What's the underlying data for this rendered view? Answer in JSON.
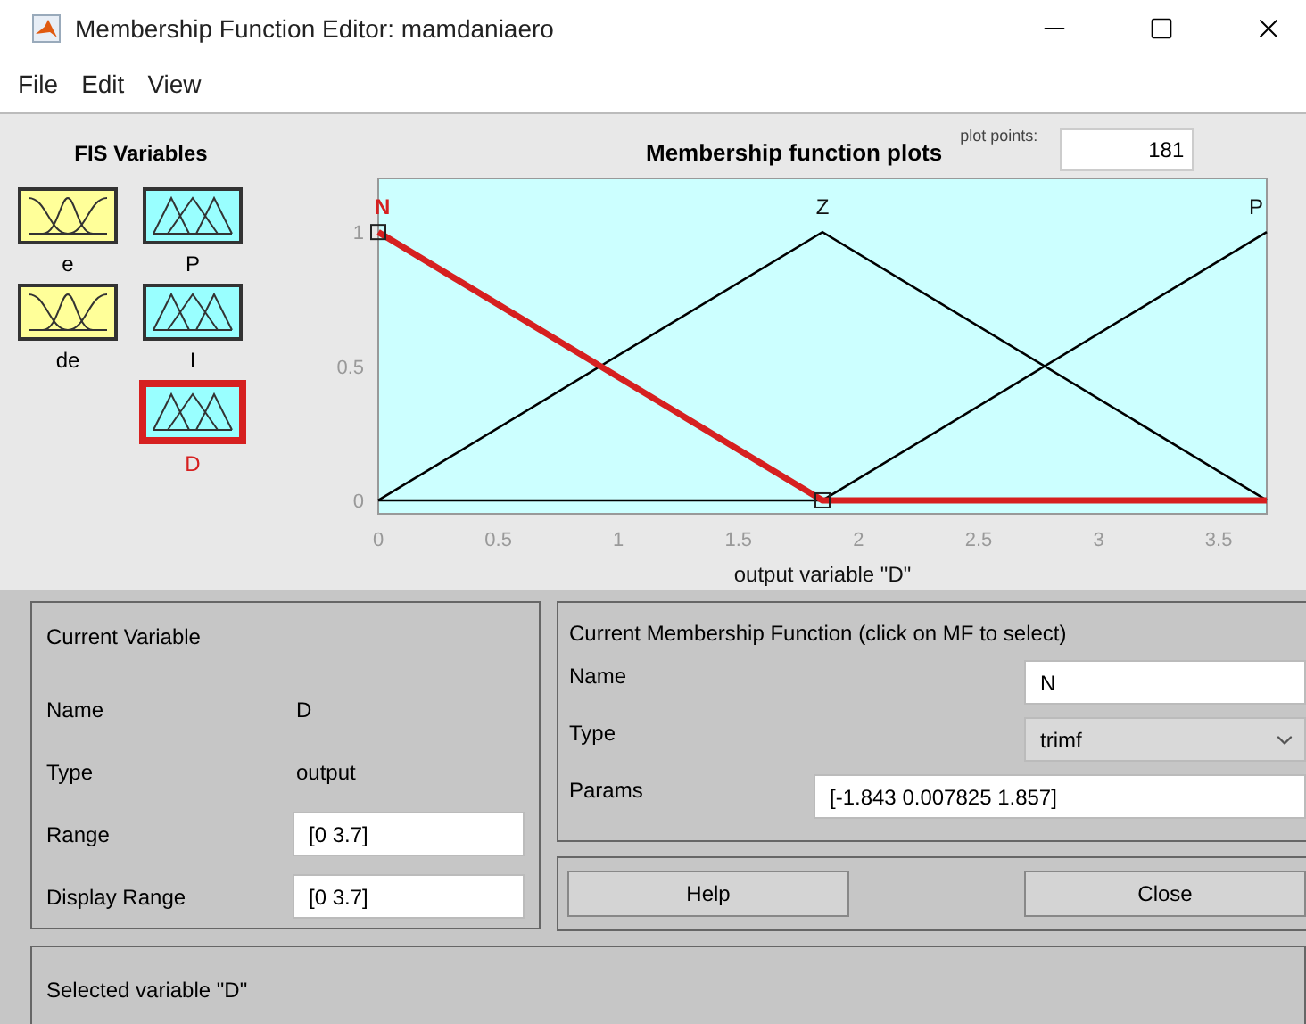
{
  "window": {
    "title": "Membership Function Editor: mamdaniaero"
  },
  "menu": [
    "File",
    "Edit",
    "View"
  ],
  "fis_variables": {
    "title": "FIS Variables",
    "items": [
      {
        "label": "e",
        "kind": "input",
        "selected": false
      },
      {
        "label": "de",
        "kind": "input",
        "selected": false
      },
      {
        "label": "P",
        "kind": "output",
        "selected": false
      },
      {
        "label": "I",
        "kind": "output",
        "selected": false
      },
      {
        "label": "D",
        "kind": "output",
        "selected": true
      }
    ]
  },
  "plot": {
    "title": "Membership function plots",
    "plot_points_label": "plot points:",
    "plot_points": "181",
    "chart_data": {
      "type": "line",
      "xlabel": "output variable \"D\"",
      "x": [
        0,
        1.85,
        3.7
      ],
      "series": [
        {
          "name": "N",
          "color": "#d62020",
          "values": [
            1,
            0,
            0
          ]
        },
        {
          "name": "Z",
          "color": "#000000",
          "values": [
            0,
            1,
            0
          ]
        },
        {
          "name": "P",
          "color": "#000000",
          "values": [
            0,
            0,
            1
          ]
        }
      ],
      "xlim": [
        0,
        3.7
      ],
      "ylim": [
        -0.05,
        1.2
      ],
      "xticks": [
        0,
        0.5,
        1,
        1.5,
        2,
        2.5,
        3,
        3.5
      ],
      "yticks": [
        0,
        0.5,
        1
      ]
    },
    "membership_functions": [
      {
        "selected": true
      },
      {
        "selected": false
      },
      {
        "selected": false
      }
    ]
  },
  "current_variable": {
    "title": "Current Variable",
    "fields": [
      {
        "label": "Name",
        "value": "D",
        "kind": "text"
      },
      {
        "label": "Type",
        "value": "output",
        "kind": "text"
      },
      {
        "label": "Range",
        "value": "[0 3.7]",
        "kind": "input"
      },
      {
        "label": "Display Range",
        "value": "[0 3.7]",
        "kind": "input"
      }
    ]
  },
  "current_mf": {
    "title": "Current Membership Function (click on MF to select)",
    "fields": [
      {
        "label": "Name",
        "value": "N",
        "kind": "input"
      },
      {
        "label": "Type",
        "value": "trimf",
        "kind": "dropdown"
      },
      {
        "label": "Params",
        "value": "[-1.843 0.007825 1.857]",
        "kind": "wide_input"
      }
    ]
  },
  "buttons": [
    "Help",
    "Close"
  ],
  "status": "Selected variable \"D\""
}
